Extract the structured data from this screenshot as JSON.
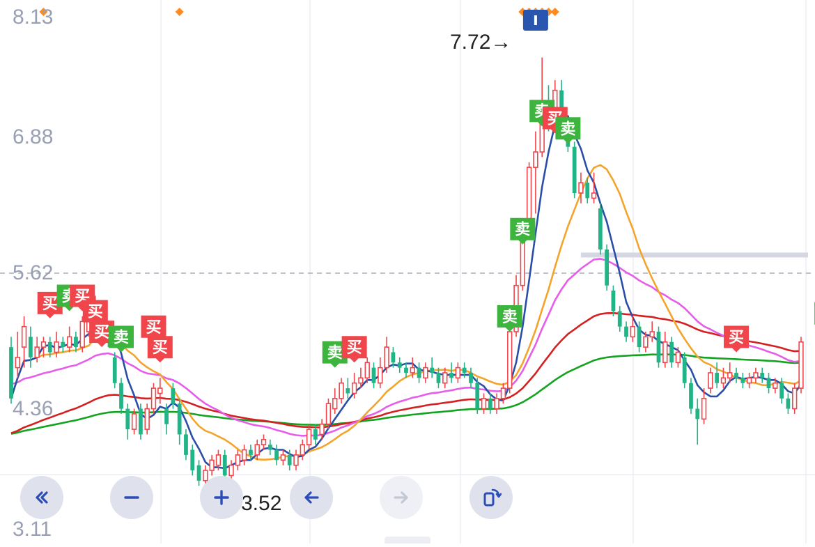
{
  "chart_data": {
    "type": "candlestick",
    "title": "",
    "ylim": [
      3.11,
      8.13
    ],
    "y_tick_labels": [
      "8.13",
      "6.88",
      "5.62",
      "4.36",
      "3.11"
    ],
    "reference_line": 5.62,
    "annotations": {
      "high": {
        "value": "7.72",
        "text": "7.72→"
      },
      "low": {
        "value": "3.52",
        "text": "←3.52"
      }
    },
    "colors": {
      "up": "#f0454a",
      "down": "#20b486",
      "ma5": "#2a4ea8",
      "ma10": "#f3a42b",
      "ma20": "#e55de8",
      "ma60": "#d42020",
      "ma120": "#13a31f",
      "buy": "#f0454a",
      "sell": "#3db43d"
    },
    "candles": [
      [
        4.9,
        4.4,
        5.0,
        4.35
      ],
      [
        4.7,
        4.8,
        5.05,
        4.6
      ],
      [
        4.9,
        5.1,
        5.2,
        4.7
      ],
      [
        5.0,
        4.8,
        5.1,
        4.7
      ],
      [
        4.8,
        4.9,
        5.0,
        4.75
      ],
      [
        4.9,
        4.95,
        5.0,
        4.8
      ],
      [
        4.95,
        4.85,
        5.0,
        4.8
      ],
      [
        4.85,
        4.95,
        5.05,
        4.8
      ],
      [
        4.95,
        4.9,
        5.0,
        4.85
      ],
      [
        4.9,
        5.0,
        5.1,
        4.85
      ],
      [
        5.0,
        4.9,
        5.05,
        4.85
      ],
      [
        4.9,
        5.15,
        5.2,
        4.85
      ],
      [
        5.05,
        5.2,
        5.3,
        5.0
      ],
      [
        5.2,
        5.35,
        5.4,
        5.1
      ],
      [
        5.3,
        5.05,
        5.35,
        5.0
      ],
      [
        5.0,
        4.95,
        5.1,
        4.9
      ],
      [
        4.8,
        4.55,
        4.85,
        4.5
      ],
      [
        4.55,
        4.3,
        4.6,
        4.25
      ],
      [
        4.3,
        4.1,
        4.35,
        4.0
      ],
      [
        4.1,
        4.25,
        4.3,
        4.05
      ],
      [
        4.3,
        4.05,
        4.35,
        4.0
      ],
      [
        4.1,
        4.3,
        4.35,
        4.05
      ],
      [
        4.3,
        4.5,
        4.55,
        4.25
      ],
      [
        4.45,
        4.5,
        4.6,
        4.35
      ],
      [
        4.3,
        4.15,
        4.35,
        4.05
      ],
      [
        4.5,
        4.35,
        4.55,
        4.3
      ],
      [
        4.35,
        4.05,
        4.4,
        3.95
      ],
      [
        4.05,
        3.85,
        4.1,
        3.8
      ],
      [
        3.9,
        3.7,
        3.95,
        3.65
      ],
      [
        3.75,
        3.6,
        3.8,
        3.55
      ],
      [
        3.6,
        3.7,
        3.75,
        3.55
      ],
      [
        3.7,
        3.8,
        3.85,
        3.65
      ],
      [
        3.75,
        3.85,
        3.9,
        3.7
      ],
      [
        3.85,
        3.65,
        3.9,
        3.52
      ],
      [
        3.65,
        3.75,
        3.8,
        3.6
      ],
      [
        3.75,
        3.85,
        3.9,
        3.7
      ],
      [
        3.8,
        3.9,
        3.95,
        3.75
      ],
      [
        3.9,
        3.85,
        3.95,
        3.8
      ],
      [
        3.85,
        3.95,
        4.0,
        3.8
      ],
      [
        3.95,
        4.0,
        4.05,
        3.9
      ],
      [
        3.95,
        3.9,
        4.0,
        3.85
      ],
      [
        3.9,
        3.8,
        3.95,
        3.75
      ],
      [
        3.8,
        3.85,
        3.9,
        3.75
      ],
      [
        3.85,
        3.75,
        3.9,
        3.7
      ],
      [
        3.75,
        3.85,
        3.9,
        3.7
      ],
      [
        3.85,
        3.95,
        4.0,
        3.8
      ],
      [
        3.95,
        4.1,
        4.15,
        3.9
      ],
      [
        4.1,
        4.0,
        4.15,
        3.95
      ],
      [
        4.05,
        4.15,
        4.2,
        4.0
      ],
      [
        4.15,
        4.35,
        4.4,
        4.1
      ],
      [
        4.3,
        4.4,
        4.5,
        4.25
      ],
      [
        4.4,
        4.55,
        4.6,
        4.35
      ],
      [
        4.5,
        4.45,
        4.6,
        4.4
      ],
      [
        4.45,
        4.55,
        4.65,
        4.4
      ],
      [
        4.55,
        4.6,
        4.7,
        4.5
      ],
      [
        4.6,
        4.75,
        4.8,
        4.55
      ],
      [
        4.7,
        4.55,
        4.75,
        4.5
      ],
      [
        4.55,
        4.7,
        4.8,
        4.5
      ],
      [
        4.7,
        4.9,
        5.0,
        4.65
      ],
      [
        4.85,
        4.75,
        4.9,
        4.7
      ],
      [
        4.75,
        4.7,
        4.8,
        4.65
      ],
      [
        4.7,
        4.65,
        4.75,
        4.6
      ],
      [
        4.65,
        4.7,
        4.8,
        4.6
      ],
      [
        4.7,
        4.6,
        4.75,
        4.55
      ],
      [
        4.6,
        4.7,
        4.75,
        4.55
      ],
      [
        4.7,
        4.65,
        4.8,
        4.6
      ],
      [
        4.65,
        4.55,
        4.7,
        4.5
      ],
      [
        4.55,
        4.65,
        4.7,
        4.5
      ],
      [
        4.65,
        4.6,
        4.75,
        4.55
      ],
      [
        4.6,
        4.7,
        4.75,
        4.55
      ],
      [
        4.7,
        4.65,
        4.75,
        4.6
      ],
      [
        4.65,
        4.55,
        4.7,
        4.5
      ],
      [
        4.55,
        4.3,
        4.6,
        4.25
      ],
      [
        4.3,
        4.4,
        4.45,
        4.25
      ],
      [
        4.4,
        4.3,
        4.45,
        4.25
      ],
      [
        4.3,
        4.4,
        4.45,
        4.25
      ],
      [
        4.4,
        4.5,
        4.55,
        4.35
      ],
      [
        4.5,
        5.05,
        5.1,
        4.45
      ],
      [
        5.05,
        5.5,
        5.6,
        5.0
      ],
      [
        5.5,
        6.05,
        6.1,
        5.45
      ],
      [
        6.05,
        6.65,
        6.7,
        6.0
      ],
      [
        6.65,
        6.8,
        7.0,
        6.2
      ],
      [
        6.8,
        7.3,
        7.72,
        6.75
      ],
      [
        7.3,
        7.2,
        7.45,
        7.0
      ],
      [
        7.2,
        7.4,
        7.5,
        7.1
      ],
      [
        7.4,
        7.0,
        7.5,
        6.95
      ],
      [
        7.0,
        6.85,
        7.1,
        6.8
      ],
      [
        6.85,
        6.4,
        6.9,
        6.35
      ],
      [
        6.4,
        6.5,
        6.6,
        6.3
      ],
      [
        6.5,
        6.35,
        6.55,
        6.3
      ],
      [
        6.35,
        6.4,
        6.6,
        6.3
      ],
      [
        6.25,
        5.85,
        6.3,
        5.8
      ],
      [
        5.85,
        5.5,
        5.9,
        5.45
      ],
      [
        5.45,
        5.25,
        5.5,
        5.2
      ],
      [
        5.25,
        5.1,
        5.3,
        5.05
      ],
      [
        5.1,
        5.0,
        5.15,
        4.95
      ],
      [
        5.0,
        5.1,
        5.2,
        4.95
      ],
      [
        5.1,
        4.9,
        5.15,
        4.85
      ],
      [
        4.9,
        5.0,
        5.05,
        4.85
      ],
      [
        5.0,
        5.05,
        5.15,
        4.95
      ],
      [
        5.05,
        4.75,
        5.1,
        4.7
      ],
      [
        4.75,
        4.95,
        5.05,
        4.7
      ],
      [
        4.95,
        4.75,
        5.0,
        4.7
      ],
      [
        4.75,
        4.85,
        4.9,
        4.7
      ],
      [
        4.8,
        4.55,
        4.85,
        4.5
      ],
      [
        4.55,
        4.3,
        4.6,
        4.25
      ],
      [
        4.3,
        4.2,
        4.4,
        3.95
      ],
      [
        4.2,
        4.4,
        4.5,
        4.15
      ],
      [
        4.5,
        4.65,
        4.7,
        4.45
      ],
      [
        4.65,
        4.55,
        4.75,
        4.5
      ],
      [
        4.55,
        4.6,
        4.7,
        4.5
      ],
      [
        4.6,
        4.65,
        4.75,
        4.55
      ],
      [
        4.65,
        4.6,
        4.7,
        4.55
      ],
      [
        4.6,
        4.55,
        4.65,
        4.5
      ],
      [
        4.55,
        4.6,
        4.65,
        4.5
      ],
      [
        4.6,
        4.65,
        4.7,
        4.55
      ],
      [
        4.65,
        4.6,
        4.7,
        4.55
      ],
      [
        4.6,
        4.5,
        4.65,
        4.45
      ],
      [
        4.5,
        4.55,
        4.6,
        4.45
      ],
      [
        4.55,
        4.4,
        4.6,
        4.35
      ],
      [
        4.4,
        4.3,
        4.45,
        4.25
      ],
      [
        4.3,
        4.5,
        4.55,
        4.25
      ],
      [
        4.5,
        4.95,
        5.0,
        4.45
      ]
    ],
    "markers": [
      {
        "label": "买",
        "type": "buy",
        "index": 6,
        "price": 5.18
      },
      {
        "label": "卖",
        "type": "sell",
        "index": 9,
        "price": 5.25
      },
      {
        "label": "买",
        "type": "buy",
        "index": 11,
        "price": 5.25
      },
      {
        "label": "买",
        "type": "buy",
        "index": 13,
        "price": 5.1
      },
      {
        "label": "买",
        "type": "buy",
        "index": 14,
        "price": 4.9
      },
      {
        "label": "卖",
        "type": "sell",
        "index": 17,
        "price": 4.85
      },
      {
        "label": "买",
        "type": "buy",
        "index": 22,
        "price": 4.95
      },
      {
        "label": "买",
        "type": "buy",
        "index": 23,
        "price": 4.75
      },
      {
        "label": "卖",
        "type": "sell",
        "index": 50,
        "price": 4.7
      },
      {
        "label": "买",
        "type": "buy",
        "index": 53,
        "price": 4.75
      },
      {
        "label": "卖",
        "type": "sell",
        "index": 77,
        "price": 5.05
      },
      {
        "label": "卖",
        "type": "sell",
        "index": 79,
        "price": 5.9
      },
      {
        "label": "卖",
        "type": "sell",
        "index": 82,
        "price": 7.05
      },
      {
        "label": "买",
        "type": "buy",
        "index": 84,
        "price": 6.98
      },
      {
        "label": "卖",
        "type": "sell",
        "index": 86,
        "price": 6.88
      },
      {
        "label": "买",
        "type": "buy",
        "index": 112,
        "price": 4.85
      },
      {
        "label": "卖",
        "type": "sell",
        "index": 126,
        "price": 5.08
      }
    ],
    "top_event_markers": [
      5,
      26,
      79,
      80,
      81,
      82,
      83,
      84,
      126,
      127
    ],
    "resistance_level": {
      "price": 5.8,
      "start_index": 88
    }
  },
  "controls": {
    "rewind": {
      "icon": "double-chevron-left-icon",
      "enabled": true
    },
    "zoom_out": {
      "icon": "minus-icon",
      "enabled": true
    },
    "zoom_in": {
      "icon": "plus-icon",
      "enabled": true
    },
    "back": {
      "icon": "arrow-left-icon",
      "enabled": true
    },
    "forward": {
      "icon": "arrow-right-icon",
      "enabled": false
    },
    "rotate": {
      "icon": "rotate-icon",
      "enabled": true
    }
  }
}
